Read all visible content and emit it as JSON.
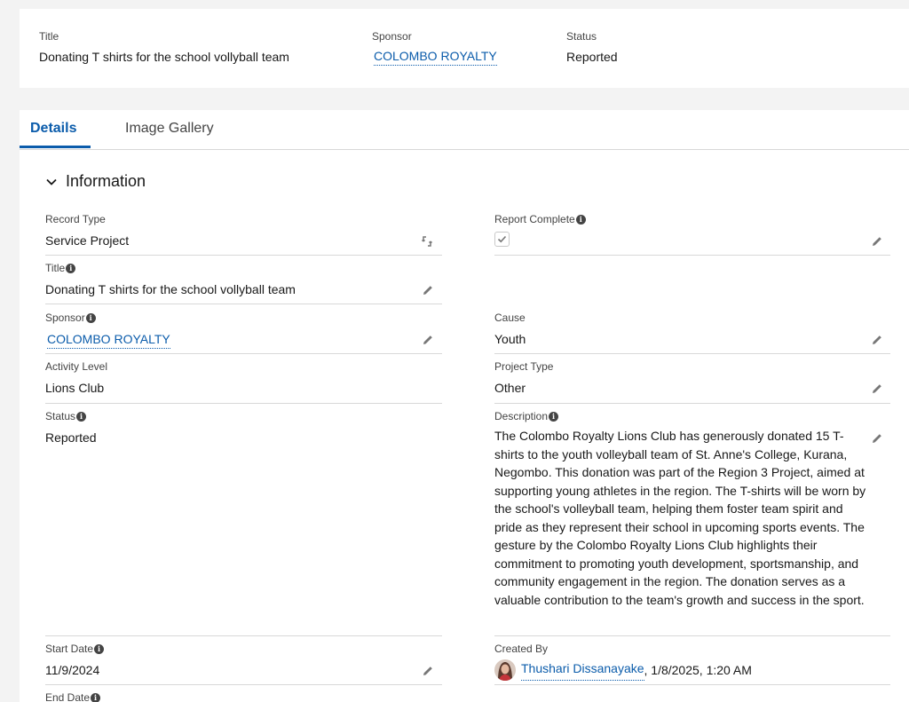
{
  "highlights": {
    "title_label": "Title",
    "title_value": "Donating T shirts for the school vollyball team",
    "sponsor_label": "Sponsor",
    "sponsor_value": "COLOMBO ROYALTY",
    "status_label": "Status",
    "status_value": "Reported"
  },
  "tabs": [
    {
      "label": "Details"
    },
    {
      "label": "Image Gallery"
    }
  ],
  "section": {
    "title": "Information"
  },
  "fields": {
    "record_type": {
      "label": "Record Type",
      "value": "Service Project"
    },
    "report_complete": {
      "label": "Report Complete",
      "checked": true
    },
    "title": {
      "label": "Title",
      "value": "Donating T shirts for the school vollyball team"
    },
    "sponsor": {
      "label": "Sponsor",
      "value": "COLOMBO ROYALTY"
    },
    "cause": {
      "label": "Cause",
      "value": "Youth"
    },
    "activity_level": {
      "label": "Activity Level",
      "value": "Lions Club"
    },
    "project_type": {
      "label": "Project Type",
      "value": "Other"
    },
    "status": {
      "label": "Status",
      "value": "Reported"
    },
    "description": {
      "label": "Description",
      "value": "The Colombo Royalty Lions Club has generously donated 15 T-shirts to the youth volleyball team of St. Anne's College, Kurana, Negombo. This donation was part of the Region 3 Project, aimed at supporting young athletes in the region. The T-shirts will be worn by the school's volleyball team, helping them foster team spirit and pride as they represent their school in upcoming sports events. The gesture by the Colombo Royalty Lions Club highlights their commitment to promoting youth development, sportsmanship, and community engagement in the region. The donation serves as a valuable contribution to the team's growth and success in the sport."
    },
    "start_date": {
      "label": "Start Date",
      "value": "11/9/2024"
    },
    "created_by": {
      "label": "Created By",
      "user": "Thushari Dissanayake",
      "timestamp": ", 1/8/2025, 1:20 AM"
    },
    "end_date": {
      "label": "End Date"
    }
  },
  "colors": {
    "link": "#0b5cab",
    "border": "#d8d8d8",
    "label": "#444444"
  },
  "icons": [
    "chevron-down-icon",
    "info-icon",
    "pencil-icon",
    "lookup-swap-icon",
    "checkbox-icon",
    "avatar"
  ]
}
